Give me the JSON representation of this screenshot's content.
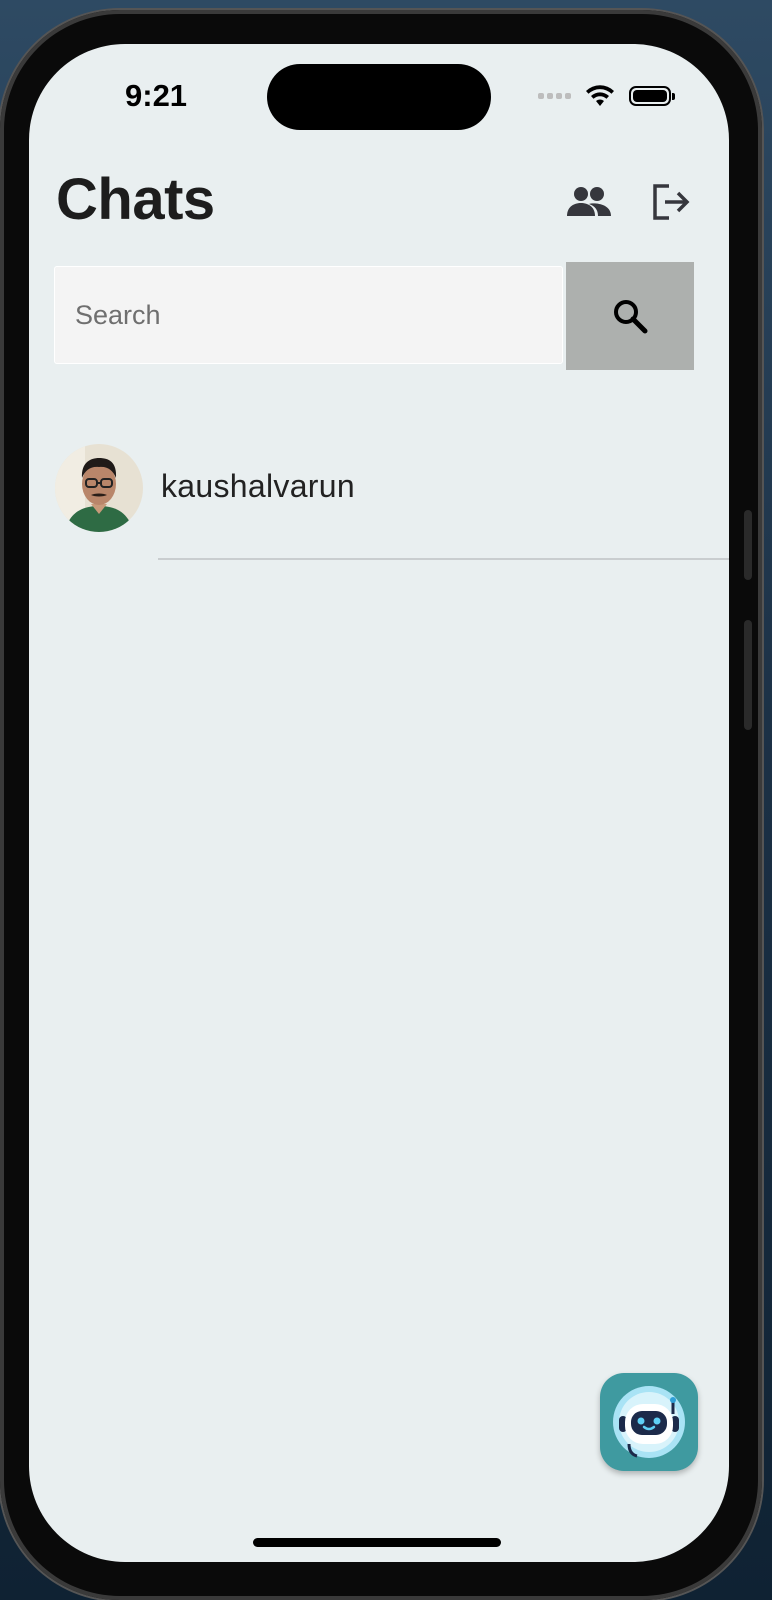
{
  "status_bar": {
    "time": "9:21"
  },
  "header": {
    "title": "Chats",
    "contacts_icon": "people-icon",
    "logout_icon": "logout-icon"
  },
  "search": {
    "placeholder": "Search",
    "value": "",
    "button_icon": "search-icon"
  },
  "chats": [
    {
      "name": "kaushalvarun",
      "avatar": "user-photo"
    }
  ],
  "fab": {
    "icon": "robot-icon"
  },
  "colors": {
    "screen_background": "#e9eff0",
    "search_button": "#adb0ae",
    "fab_background": "#3f9aa0",
    "title_text": "#1d1d1d"
  }
}
